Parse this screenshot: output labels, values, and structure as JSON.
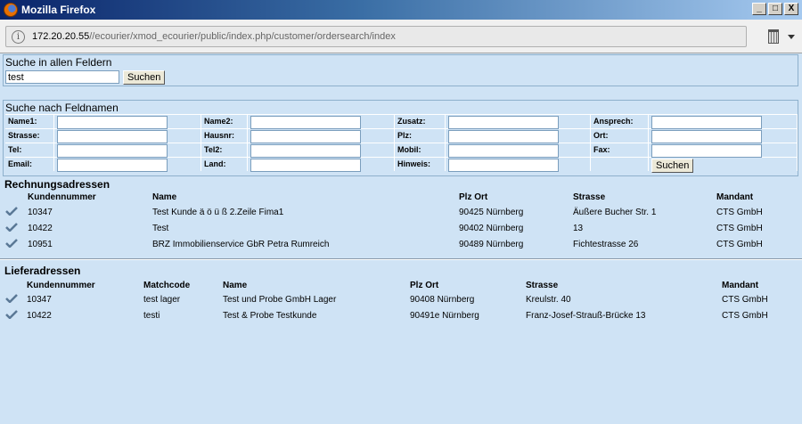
{
  "window": {
    "title": "Mozilla Firefox",
    "min": "_",
    "max": "□",
    "close": "X"
  },
  "browser": {
    "info": "i",
    "url_host": "172.20.20.55",
    "url_path": "//ecourier/xmod_ecourier/public/index.php/customer/ordersearch/index"
  },
  "search_all": {
    "title": "Suche in allen Feldern",
    "value": "test",
    "button": "Suchen"
  },
  "search_fields": {
    "title": "Suche nach Feldnamen",
    "labels": {
      "name1": "Name1:",
      "name2": "Name2:",
      "zusatz": "Zusatz:",
      "ansprech": "Ansprech:",
      "strasse": "Strasse:",
      "hausnr": "Hausnr:",
      "plz": "Plz:",
      "ort": "Ort:",
      "tel": "Tel:",
      "tel2": "Tel2:",
      "mobil": "Mobil:",
      "fax": "Fax:",
      "email": "Email:",
      "land": "Land:",
      "hinweis": "Hinweis:"
    },
    "button": "Suchen"
  },
  "rechnung": {
    "title": "Rechnungsadressen",
    "headers": [
      "Kundennummer",
      "Name",
      "Plz Ort",
      "Strasse",
      "Mandant"
    ],
    "rows": [
      [
        "10347",
        "Test Kunde ä ö ü ß 2.Zeile Fima1",
        "90425 Nürnberg",
        "Äußere Bucher Str. 1",
        "CTS GmbH"
      ],
      [
        "10422",
        "Test",
        "90402 Nürnberg",
        "13",
        "CTS GmbH"
      ],
      [
        "10951",
        "BRZ Immobilienservice GbR Petra Rumreich",
        "90489 Nürnberg",
        "Fichtestrasse 26",
        "CTS GmbH"
      ]
    ]
  },
  "liefer": {
    "title": "Lieferadressen",
    "headers": [
      "Kundennummer",
      "Matchcode",
      "Name",
      "Plz Ort",
      "Strasse",
      "Mandant"
    ],
    "rows": [
      [
        "10347",
        "test lager",
        "Test und Probe GmbH Lager",
        "90408 Nürnberg",
        "Kreulstr. 40",
        "CTS GmbH"
      ],
      [
        "10422",
        "testi",
        "Test & Probe Testkunde",
        "90491e Nürnberg",
        "Franz-Josef-Strauß-Brücke 13",
        "CTS GmbH"
      ]
    ]
  }
}
